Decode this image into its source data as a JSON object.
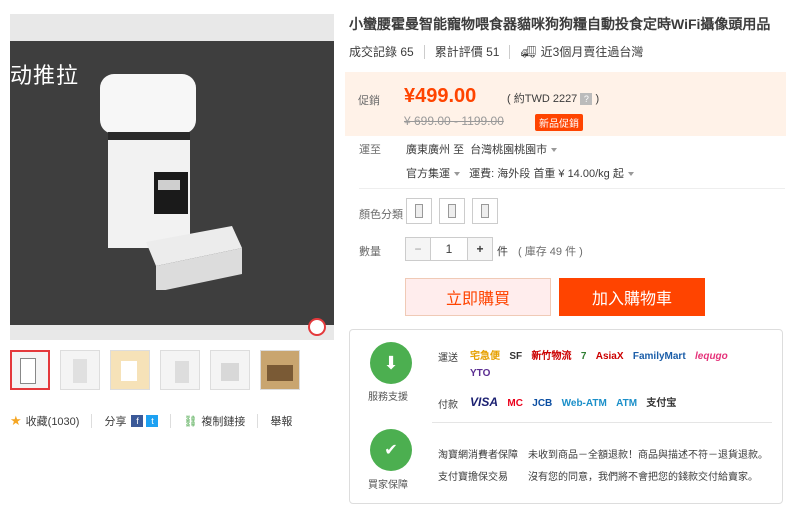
{
  "product": {
    "title": "小蠻腰霍曼智能寵物喂食器貓咪狗狗糧自動投食定時WiFi攝像頭用品",
    "image_text": "动推拉"
  },
  "stats": {
    "deals_label": "成交記錄",
    "deals_value": "65",
    "reviews_label": "累計評價",
    "reviews_value": "51",
    "shipping_note": "近3個月賣往過台灣"
  },
  "price": {
    "promo_label": "促銷",
    "current": "¥499.00",
    "twd_prefix": "( 約TWD",
    "twd_value": "2227",
    "twd_help": "?",
    "twd_suffix": ")",
    "original": "¥ 699.00 - 1199.00",
    "badge": "新品促銷"
  },
  "shipping": {
    "label": "運至",
    "from": "廣東廣州",
    "to_word": "至",
    "destination": "台灣桃園桃園市",
    "method": "官方集運",
    "fee": "運費: 海外段 首重 ¥ 14.00/kg 起"
  },
  "options": {
    "color_label": "顏色分類",
    "qty_label": "數量",
    "qty_value": "1",
    "qty_minus": "−",
    "qty_plus": "+",
    "qty_unit": "件",
    "stock": "( 庫存 49 件 )"
  },
  "buttons": {
    "buy_now": "立即購買",
    "add_cart": "加入購物車"
  },
  "actions": {
    "favorite": "收藏(1030)",
    "share": "分享",
    "copy_link": "複制鏈接",
    "report": "舉報"
  },
  "service": {
    "support_label": "服務支援",
    "guarantee_label": "買家保障",
    "delivery_label": "運送",
    "payment_label": "付款",
    "delivery_logos": [
      "宅急便",
      "SF",
      "新竹物流",
      "7",
      "AsiaX",
      "FamilyMart",
      "lequgo",
      "YTO"
    ],
    "payment_logos": [
      "VISA",
      "MC",
      "JCB",
      "Web-ATM",
      "ATM",
      "支付宝"
    ],
    "g1_title": "淘寶網消費者保障",
    "g1_text": "未收到商品－全額退款！商品與描述不符－退貨退款。",
    "g2_title": "支付寶擔保交易",
    "g2_text": "沒有您的同意，我們將不會把您的錢款交付給賣家。"
  },
  "colors": {
    "accent": "#ff4400",
    "price_bg": "#fff2e8",
    "buy_now_bg": "#ffeded",
    "cart_bg": "#ff4400"
  }
}
